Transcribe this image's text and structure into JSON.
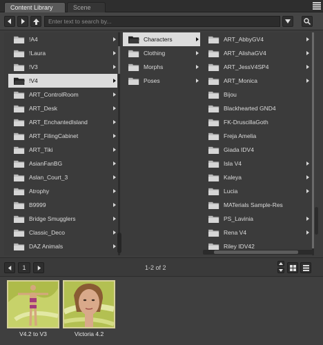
{
  "tabs": [
    {
      "label": "Content Library"
    },
    {
      "label": "Scene"
    }
  ],
  "search": {
    "placeholder": "Enter text to search by..."
  },
  "columns": {
    "col1": {
      "items": [
        {
          "label": "!A4"
        },
        {
          "label": "!Laura"
        },
        {
          "label": "!V3"
        },
        {
          "label": "!V4"
        },
        {
          "label": "ART_ControlRoom"
        },
        {
          "label": "ART_Desk"
        },
        {
          "label": "ART_EnchantedIsland"
        },
        {
          "label": "ART_FilingCabinet"
        },
        {
          "label": "ART_Tiki"
        },
        {
          "label": "AsianFanBG"
        },
        {
          "label": "Aslan_Court_3"
        },
        {
          "label": "Atrophy"
        },
        {
          "label": "B9999"
        },
        {
          "label": "Bridge Smugglers"
        },
        {
          "label": "Classic_Deco"
        },
        {
          "label": "DAZ Animals"
        }
      ],
      "selected_index": 3
    },
    "col2": {
      "items": [
        {
          "label": "Characters"
        },
        {
          "label": "Clothing"
        },
        {
          "label": "Morphs"
        },
        {
          "label": "Poses"
        }
      ],
      "selected_index": 0
    },
    "col3": {
      "items": [
        {
          "label": "ART_AbbyGV4"
        },
        {
          "label": "ART_AlishaGV4"
        },
        {
          "label": "ART_JessV4SP4"
        },
        {
          "label": "ART_Monica"
        },
        {
          "label": "Bijou"
        },
        {
          "label": "Blackhearted GND4"
        },
        {
          "label": "FK-DruscillaGoth"
        },
        {
          "label": "Freja Amelia"
        },
        {
          "label": "Giada IDV4"
        },
        {
          "label": "Isla V4"
        },
        {
          "label": "Kaleya"
        },
        {
          "label": "Lucia"
        },
        {
          "label": "MATerials Sample-Res"
        },
        {
          "label": "PS_Lavinia"
        },
        {
          "label": "Rena V4"
        },
        {
          "label": "Riley IDV42"
        }
      ]
    }
  },
  "pager": {
    "page": "1",
    "info": "1-2 of 2"
  },
  "thumbnails": [
    {
      "caption": "V4.2 to V3"
    },
    {
      "caption": "Victoria 4.2"
    }
  ],
  "colors": {
    "accent_folder": "#c9c9c9",
    "thumb_bg": "#b7c25a",
    "selected_row": "#dcdcdc"
  }
}
